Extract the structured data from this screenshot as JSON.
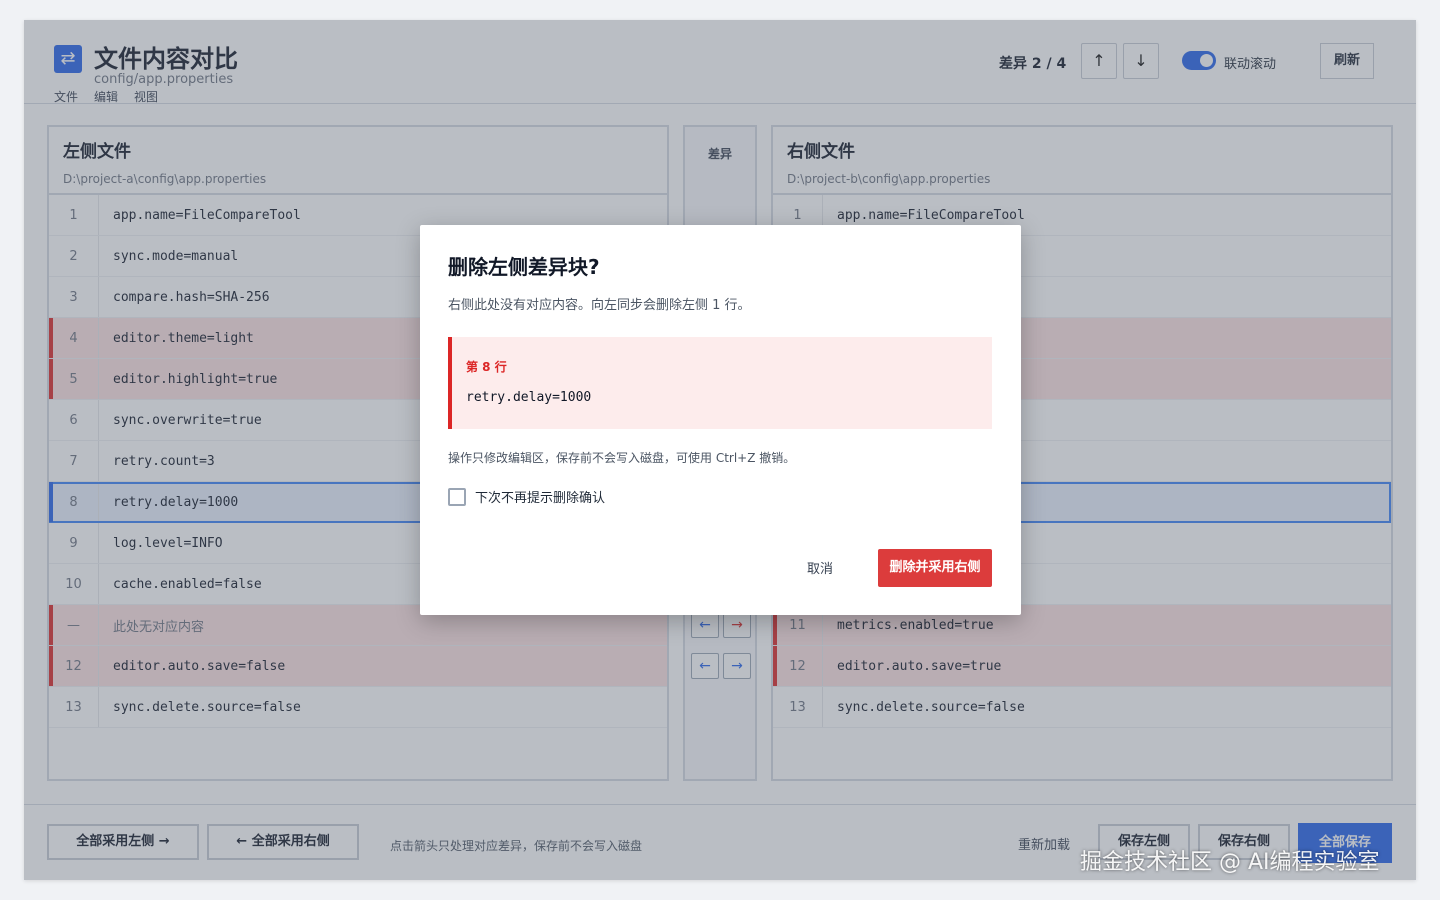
{
  "header": {
    "title": "文件内容对比",
    "subtitle": "config/app.properties",
    "menu": [
      "文件",
      "编辑",
      "视图"
    ],
    "diff_counter": "差异 2 / 4",
    "prev_label": "↑",
    "next_label": "↓",
    "sync_scroll_label": "联动滚动",
    "sync_scroll_on": true,
    "refresh_label": "刷新",
    "logo_glyph": "⇄"
  },
  "left": {
    "title": "左侧文件",
    "path": "D:\\project-a\\config\\app.properties",
    "rows": [
      {
        "ln": "1",
        "code": "app.name=FileCompareTool",
        "state": "normal"
      },
      {
        "ln": "2",
        "code": "sync.mode=manual",
        "state": "normal"
      },
      {
        "ln": "3",
        "code": "compare.hash=SHA-256",
        "state": "normal"
      },
      {
        "ln": "4",
        "code": "editor.theme=light",
        "state": "del"
      },
      {
        "ln": "5",
        "code": "editor.highlight=true",
        "state": "del"
      },
      {
        "ln": "6",
        "code": "sync.overwrite=true",
        "state": "normal"
      },
      {
        "ln": "7",
        "code": "retry.count=3",
        "state": "normal"
      },
      {
        "ln": "8",
        "code": "retry.delay=1000",
        "state": "current"
      },
      {
        "ln": "9",
        "code": "log.level=INFO",
        "state": "normal"
      },
      {
        "ln": "10",
        "code": "cache.enabled=false",
        "state": "normal"
      },
      {
        "ln": "—",
        "code": "此处无对应内容",
        "state": "del-placeholder"
      },
      {
        "ln": "12",
        "code": "editor.auto.save=false",
        "state": "del"
      },
      {
        "ln": "13",
        "code": "sync.delete.source=false",
        "state": "normal"
      }
    ]
  },
  "right": {
    "title": "右侧文件",
    "path": "D:\\project-b\\config\\app.properties",
    "rows": [
      {
        "ln": "1",
        "code": "app.name=FileCompareTool",
        "state": "normal"
      },
      {
        "ln": "",
        "code": "",
        "state": "normal"
      },
      {
        "ln": "",
        "code": "",
        "state": "normal"
      },
      {
        "ln": "",
        "code": "",
        "state": "del"
      },
      {
        "ln": "",
        "code": "",
        "state": "del"
      },
      {
        "ln": "",
        "code": "",
        "state": "normal"
      },
      {
        "ln": "",
        "code": "",
        "state": "normal"
      },
      {
        "ln": "",
        "code": "",
        "state": "current"
      },
      {
        "ln": "",
        "code": "",
        "state": "normal"
      },
      {
        "ln": "",
        "code": "",
        "state": "normal"
      },
      {
        "ln": "11",
        "code": "metrics.enabled=true",
        "state": "del"
      },
      {
        "ln": "12",
        "code": "editor.auto.save=true",
        "state": "del"
      },
      {
        "ln": "13",
        "code": "sync.delete.source=false",
        "state": "normal"
      }
    ]
  },
  "gutter": {
    "title": "差异",
    "left_arrow": "←",
    "right_arrow": "→"
  },
  "footer": {
    "use_all_left": "全部采用左侧 →",
    "use_all_right": "← 全部采用右侧",
    "hint": "点击箭头只处理对应差异，保存前不会写入磁盘",
    "reload": "重新加载",
    "save_left": "保存左侧",
    "save_right": "保存右侧",
    "save_all": "全部保存"
  },
  "dialog": {
    "title": "删除左侧差异块?",
    "description": "右侧此处没有对应内容。向左同步会删除左侧 1 行。",
    "block_label": "第 8 行",
    "block_code": "retry.delay=1000",
    "note": "操作只修改编辑区，保存前不会写入磁盘，可使用 Ctrl+Z 撤销。",
    "checkbox_label": "下次不再提示删除确认",
    "checkbox_checked": false,
    "cancel_label": "取消",
    "confirm_label": "删除并采用右侧"
  },
  "watermark": "掘金技术社区 @ AI编程实验室",
  "colors": {
    "accent": "#2563eb",
    "danger": "#dc3c3c",
    "diff_bg": "#fde2e2"
  }
}
